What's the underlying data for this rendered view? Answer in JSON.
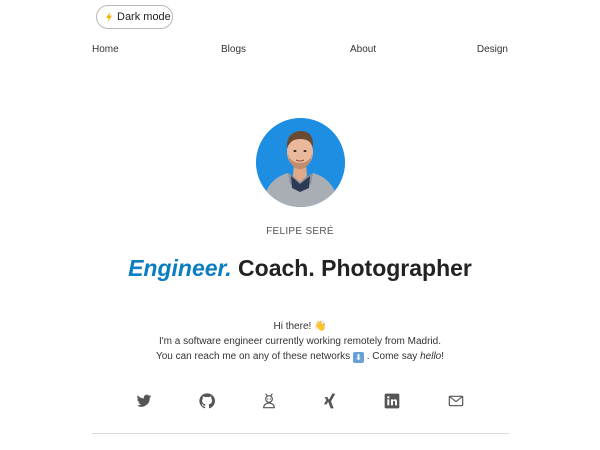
{
  "toggle": {
    "label": "Dark mode",
    "icon": "lightning-bolt-icon"
  },
  "nav": {
    "items": [
      "Home",
      "Blogs",
      "About",
      "Design"
    ]
  },
  "profile": {
    "name": "FELIPE SERÉ",
    "avatar": "avatar-portrait"
  },
  "headline": {
    "highlight": "Engineer.",
    "rest": " Coach. Photographer"
  },
  "intro": {
    "line1": "Hi there! 👋",
    "line2": "I'm a software engineer currently working remotely from Madrid.",
    "line3_before": "You can reach me on any of these networks ",
    "line3_arrow": "⬇",
    "line3_after": " . Come say ",
    "line3_em": "hello",
    "line3_end": "!"
  },
  "social": [
    "twitter-icon",
    "github-icon",
    "recurse-icon",
    "xing-icon",
    "linkedin-icon",
    "email-icon"
  ],
  "colors": {
    "accent": "#0b7dc2",
    "avatar_bg": "#1e8ee3",
    "text": "#333333"
  }
}
